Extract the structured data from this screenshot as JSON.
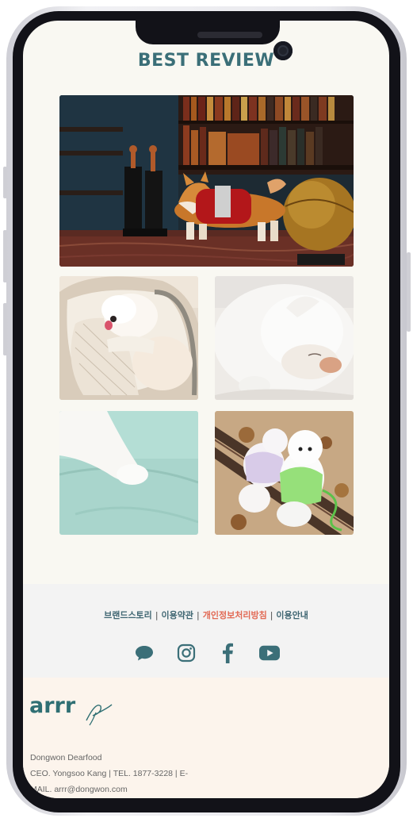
{
  "page": {
    "title": "BEST REVIEW"
  },
  "photos": [
    {
      "name": "photo-dog-library",
      "alt": "dog in red coat in library"
    },
    {
      "name": "photo-dog-in-bag",
      "alt": "white puppy in carrier bag"
    },
    {
      "name": "photo-sleeping-dog",
      "alt": "white dog sleeping"
    },
    {
      "name": "photo-dog-paw-cushion",
      "alt": "dog paw on mint cushion"
    },
    {
      "name": "photo-dogs-on-bench",
      "alt": "two dogs in jackets on bench"
    }
  ],
  "footer": {
    "links": [
      {
        "label": "브랜드스토리",
        "highlight": false
      },
      {
        "label": "이용약관",
        "highlight": false
      },
      {
        "label": "개인정보처리방침",
        "highlight": true
      },
      {
        "label": "이용안내",
        "highlight": false
      }
    ],
    "separator": "|",
    "socials": [
      "chat-icon",
      "instagram-icon",
      "facebook-icon",
      "youtube-icon"
    ]
  },
  "brand": {
    "logo_text": "arrr",
    "company": "Dongwon Dearfood",
    "line2": "CEO. Yongsoo Kang | TEL. 1877-3228 | E-",
    "line3": "MAIL. arrr@dongwon.com"
  },
  "colors": {
    "accent": "#3b6f78",
    "highlight": "#e26a55",
    "screen_bg": "#f9f8f2",
    "footer_bg": "#f3f3f3",
    "brand_bg": "#fcf4ec"
  }
}
